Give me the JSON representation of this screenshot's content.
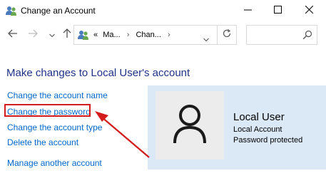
{
  "window": {
    "title": "Change an Account",
    "app_icon": "users-icon",
    "buttons": [
      "minimize-icon",
      "maximize-icon",
      "close-icon"
    ]
  },
  "navigation": {
    "address_prefix": "«",
    "breadcrumb": [
      "Ma...",
      "Chan..."
    ],
    "separator": "›"
  },
  "content": {
    "heading": "Make changes to Local User's account",
    "links": [
      "Change the account name",
      "Change the password",
      "Change the account type",
      "Delete the account",
      "Manage another account"
    ],
    "highlighted_link": "Change the password"
  },
  "account": {
    "name": "Local User",
    "type": "Local Account",
    "status": "Password protected"
  },
  "colors": {
    "heading": "#1e3287",
    "link": "#0066cc",
    "annotation": "#d41c1c",
    "card_background": "#dbe9f7"
  }
}
